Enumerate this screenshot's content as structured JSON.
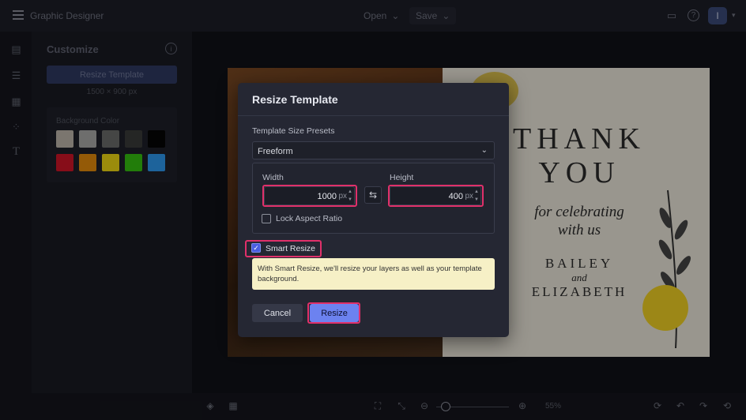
{
  "app": {
    "title": "Graphic Designer",
    "menu_open": "Open",
    "menu_save": "Save",
    "avatar_initial": "I"
  },
  "panel": {
    "title": "Customize",
    "resize_button": "Resize Template",
    "dimensions": "1500 × 900 px",
    "background_label": "Background Color",
    "swatches": [
      "#bdb6ab",
      "#a9aaa8",
      "#6b6c6a",
      "#3a3b39",
      "#050505",
      "#d01427",
      "#e48a0c",
      "#eed713",
      "#35c010",
      "#2d99ee"
    ]
  },
  "card": {
    "line1": "THANK",
    "line2": "YOU",
    "script1": "for celebrating",
    "script2": "with us",
    "name1": "BAILEY",
    "and": "and",
    "name2": "ELIZABETH"
  },
  "bottom": {
    "zoom": "55%"
  },
  "modal": {
    "title": "Resize Template",
    "presets_label": "Template Size Presets",
    "preset_value": "Freeform",
    "width_label": "Width",
    "width_value": "1000",
    "height_label": "Height",
    "height_value": "400",
    "unit": "px",
    "lock_label": "Lock Aspect Ratio",
    "smart_label": "Smart Resize",
    "smart_tip": "With Smart Resize, we'll resize your layers as well as your template background.",
    "cancel": "Cancel",
    "resize": "Resize"
  }
}
